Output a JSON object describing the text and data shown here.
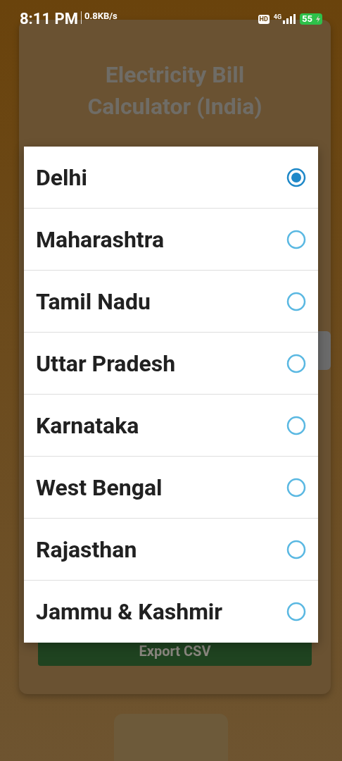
{
  "status_bar": {
    "time": "8:11 PM",
    "speed": "0.8KB/s",
    "hd": "HD",
    "network": "4G",
    "battery": "55"
  },
  "card": {
    "title": "Electricity Bill Calculator (India)",
    "export_button": "Export CSV"
  },
  "dialog": {
    "options": [
      {
        "label": "Delhi",
        "selected": true
      },
      {
        "label": "Maharashtra",
        "selected": false
      },
      {
        "label": "Tamil Nadu",
        "selected": false
      },
      {
        "label": "Uttar Pradesh",
        "selected": false
      },
      {
        "label": "Karnataka",
        "selected": false
      },
      {
        "label": "West Bengal",
        "selected": false
      },
      {
        "label": "Rajasthan",
        "selected": false
      },
      {
        "label": "Jammu & Kashmir",
        "selected": false
      }
    ]
  }
}
